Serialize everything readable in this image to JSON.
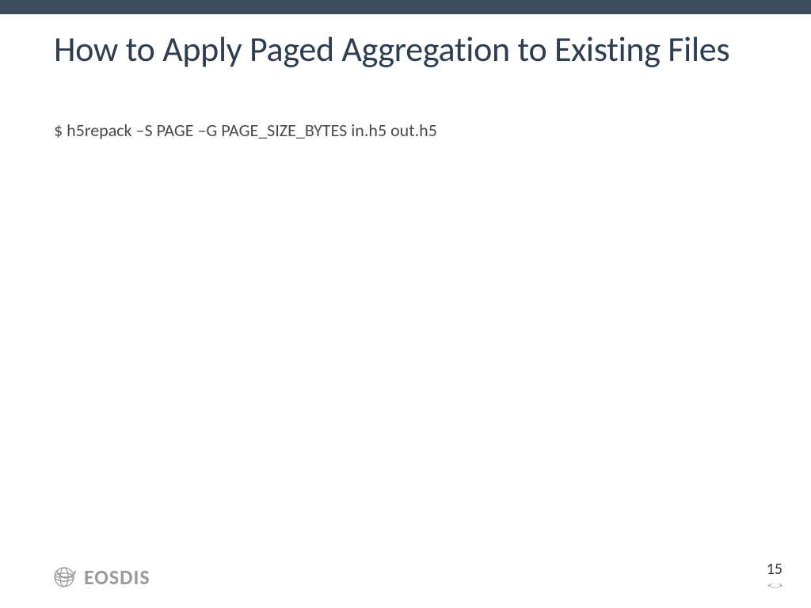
{
  "slide": {
    "title": "How to Apply Paged Aggregation to Existing Files",
    "command": "$ h5repack –S PAGE –G PAGE_SIZE_BYTES in.h5 out.h5"
  },
  "footer": {
    "logo_text": "EOSDIS",
    "page_number": "15",
    "nav_hint": "<…>"
  }
}
